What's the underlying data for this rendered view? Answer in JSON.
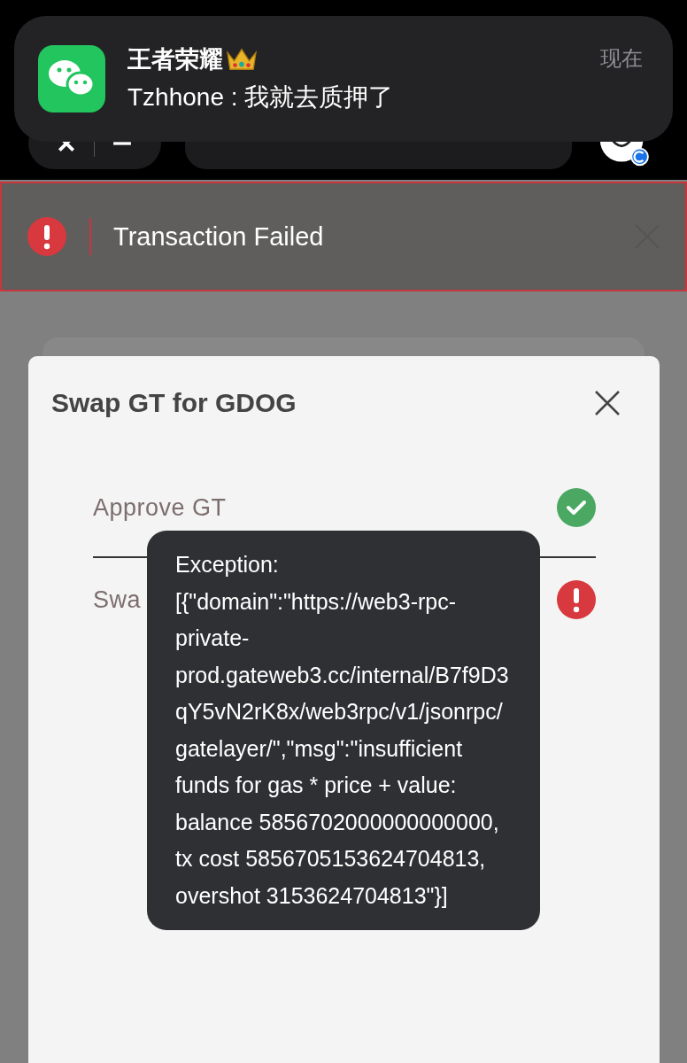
{
  "notification": {
    "title": "王者荣耀",
    "message": "Tzhhone : 我就去质押了",
    "time": "现在"
  },
  "alert": {
    "kind": "error",
    "message": "Transaction Failed"
  },
  "modal": {
    "title": "Swap GT for GDOG",
    "steps": [
      {
        "label": "Approve GT",
        "kind": "done"
      },
      {
        "label": "Swa",
        "kind": "failed"
      }
    ],
    "tooltip": "Exception: [{\"domain\":\"https://web3-rpc-private-prod.gateweb3.cc/internal/B7f9D3qY5vN2rK8x/web3rpc/v1/jsonrpc/gatelayer/\",\"msg\":\"insufficient funds for gas * price + value: balance 5856702000000000000, tx cost 5856705153624704813, overshot 3153624704813\"}]"
  }
}
